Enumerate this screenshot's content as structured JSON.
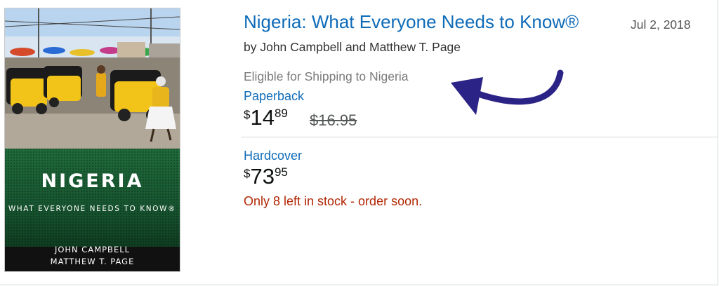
{
  "book": {
    "title": "Nigeria: What Everyone Needs to Know®",
    "date": "Jul 2, 2018",
    "byline": "by John Campbell and Matthew T. Page",
    "shipping_note": "Eligible for Shipping to Nigeria"
  },
  "cover": {
    "title": "NIGERIA",
    "subtitle": "WHAT EVERYONE NEEDS TO KNOW®",
    "author1": "JOHN CAMPBELL",
    "author2": "MATTHEW T. PAGE"
  },
  "formats": [
    {
      "name": "Paperback",
      "price": {
        "symbol": "$",
        "whole": "14",
        "fraction": "89"
      },
      "list_price": "$16.95"
    },
    {
      "name": "Hardcover",
      "price": {
        "symbol": "$",
        "whole": "73",
        "fraction": "95"
      },
      "stock_note": "Only 8 left in stock - order soon."
    }
  ],
  "colors": {
    "link": "#0f6bb8",
    "stock_warning": "#b12704",
    "annotation_arrow": "#2b2486"
  },
  "annotation": {
    "icon": "curved-arrow-icon"
  }
}
